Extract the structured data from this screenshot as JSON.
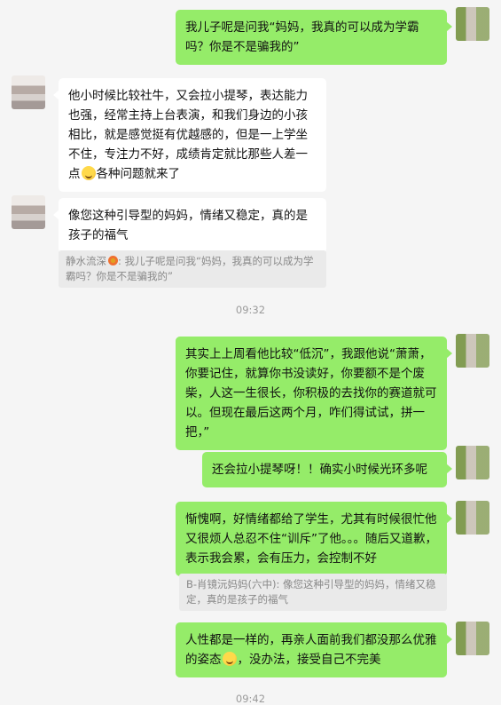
{
  "messages": [
    {
      "id": "m1",
      "side": "out",
      "text": "我儿子呢是问我“妈妈，我真的可以成为学霸吗？你是不是骗我的”"
    },
    {
      "id": "m2",
      "side": "in",
      "text_a": "他小时候比较社牛，又会拉小提琴，表达能力也强，经常主持上台表演，和我们身边的小孩相比，就是感觉挺有优越感的，但是一上学坐不住，专注力不好，成绩肯定就比那些人差一点",
      "emoji": "emoji-smile",
      "text_b": "各种问题就来了"
    },
    {
      "id": "m3",
      "side": "in",
      "text": "像您这种引导型的妈妈，情绪又稳定，真的是孩子的福气"
    },
    {
      "id": "q1",
      "type": "quote",
      "name": "静水流深",
      "sep": ":",
      "text": " 我儿子呢是问我“妈妈，我真的可以成为学霸吗？你是不是骗我的”"
    },
    {
      "id": "t1",
      "type": "time",
      "text": "09:32"
    },
    {
      "id": "m4",
      "side": "out",
      "text": "其实上上周看他比较“低沉”，我跟他说“萧萧，你要记住，就算你书没读好，你要额不是个废柴，人这一生很长，你积极的去找你的赛道就可以。但现在最后这两个月，咋们得试试，拼一把，”"
    },
    {
      "id": "m5",
      "side": "out",
      "text": "还会拉小提琴呀！！确实小时候光环多呢"
    },
    {
      "id": "m6",
      "side": "out",
      "text": "惭愧啊，好情绪都给了学生，尤其有时候很忙他又很烦人总忍不住“训斥”了他。。。随后又道歉，表示我会累，会有压力，会控制不好"
    },
    {
      "id": "q2",
      "type": "quote",
      "name": "B-肖镜沅妈妈(六中)",
      "sep": ":",
      "text": " 像您这种引导型的妈妈，情绪又稳定，真的是孩子的福气"
    },
    {
      "id": "m7",
      "side": "out",
      "text_a": "人性都是一样的，再亲人面前我们都没那么优雅的姿态",
      "emoji": "emoji-smile",
      "text_b": "，没办法，接受自己不完美"
    },
    {
      "id": "t2",
      "type": "time",
      "text": "09:42"
    }
  ]
}
